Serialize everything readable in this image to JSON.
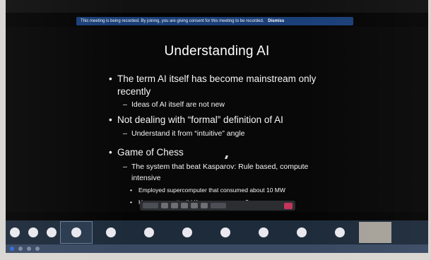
{
  "banner": {
    "text": "This meeting is being recorded. By joining, you are giving consent for this meeting to be recorded.",
    "dismiss": "Dismiss"
  },
  "slide": {
    "title": "Understanding AI",
    "bullets": [
      {
        "level": 1,
        "text": "The term AI itself has become mainstream only"
      },
      {
        "level": 1,
        "text": "recently",
        "continuation": true
      },
      {
        "level": 2,
        "text": "Ideas of AI itself are not new"
      },
      {
        "level": 1,
        "text": "Not dealing with “formal” definition of AI"
      },
      {
        "level": 2,
        "text": "Understand it from “intuitive” angle"
      },
      {
        "level": 1,
        "text": "Game of Chess"
      },
      {
        "level": 2,
        "text": "The system that beat Kasparov: Rule based, compute"
      },
      {
        "level": 2,
        "text": "intensive",
        "continuation": true
      },
      {
        "level": 3,
        "text": "Employed supercomputer that consumed about 10 MW"
      },
      {
        "level": 3,
        "text": "How many watts did Kasparov consume?"
      }
    ],
    "markers": {
      "l1": "•",
      "l2": "–",
      "l3": "•"
    }
  },
  "icons": {
    "cursor": "mouse-cursor-icon"
  }
}
